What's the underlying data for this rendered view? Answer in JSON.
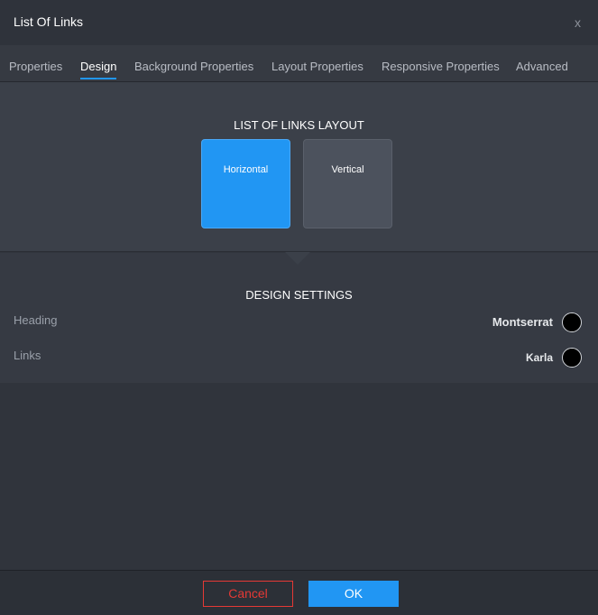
{
  "dialog": {
    "title": "List Of Links",
    "close_label": "x"
  },
  "tabs": [
    {
      "label": "Properties",
      "active": false
    },
    {
      "label": "Design",
      "active": true
    },
    {
      "label": "Background Properties",
      "active": false
    },
    {
      "label": "Layout Properties",
      "active": false
    },
    {
      "label": "Responsive Properties",
      "active": false
    },
    {
      "label": "Advanced",
      "active": false
    }
  ],
  "layout": {
    "heading": "LIST OF LINKS LAYOUT",
    "options": [
      {
        "label": "Horizontal",
        "selected": true
      },
      {
        "label": "Vertical",
        "selected": false
      }
    ]
  },
  "design": {
    "heading": "DESIGN SETTINGS",
    "rows": [
      {
        "label": "Heading",
        "font": "Montserrat",
        "color": "#000000"
      },
      {
        "label": "Links",
        "font": "Karla",
        "color": "#000000"
      }
    ]
  },
  "footer": {
    "cancel_label": "Cancel",
    "ok_label": "OK"
  },
  "colors": {
    "accent": "#2196f3",
    "danger": "#e53935"
  }
}
